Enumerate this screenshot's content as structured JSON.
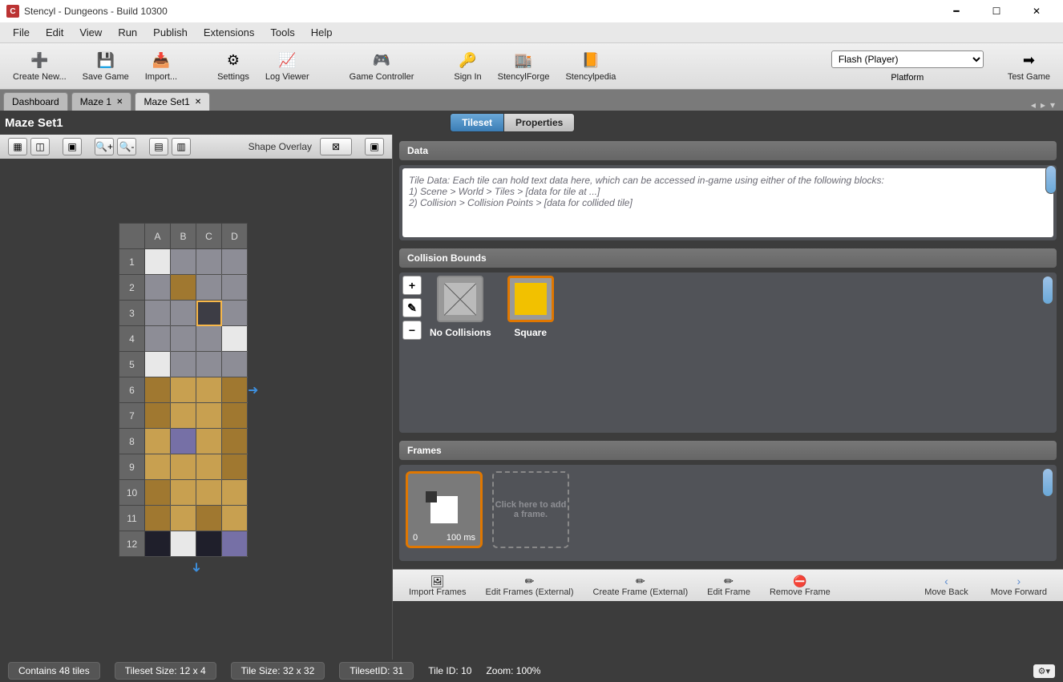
{
  "window": {
    "title": "Stencyl - Dungeons - Build 10300"
  },
  "menu": [
    "File",
    "Edit",
    "View",
    "Run",
    "Publish",
    "Extensions",
    "Tools",
    "Help"
  ],
  "toolbar": [
    {
      "label": "Create New...",
      "icon": "➕"
    },
    {
      "label": "Save Game",
      "icon": "💾"
    },
    {
      "label": "Import...",
      "icon": "📥"
    },
    {
      "label": "Settings",
      "icon": "⚙"
    },
    {
      "label": "Log Viewer",
      "icon": "📈"
    },
    {
      "label": "Game Controller",
      "icon": "🎮"
    },
    {
      "label": "Sign In",
      "icon": "🔑"
    },
    {
      "label": "StencylForge",
      "icon": "🏬"
    },
    {
      "label": "Stencylpedia",
      "icon": "📙"
    }
  ],
  "platform": {
    "value": "Flash (Player)",
    "label": "Platform"
  },
  "testgame": {
    "label": "Test Game"
  },
  "tabs": [
    {
      "label": "Dashboard",
      "closeable": false,
      "active": false
    },
    {
      "label": "Maze 1",
      "closeable": true,
      "active": false
    },
    {
      "label": "Maze Set1",
      "closeable": true,
      "active": true
    }
  ],
  "page": {
    "title": "Maze Set1"
  },
  "toggle": {
    "tileset": "Tileset",
    "properties": "Properties"
  },
  "left_toolbar": {
    "shape_overlay": "Shape Overlay"
  },
  "tile_columns": [
    "A",
    "B",
    "C",
    "D"
  ],
  "tile_rows": [
    "1",
    "2",
    "3",
    "4",
    "5",
    "6",
    "7",
    "8",
    "9",
    "10",
    "11",
    "12"
  ],
  "sections": {
    "data": {
      "header": "Data",
      "text1": "Tile Data: Each tile can hold text data here, which can be accessed in-game using either of the following blocks:",
      "text2": "1) Scene > World > Tiles > [data for tile at ...]",
      "text3": "2) Collision > Collision Points > [data for collided tile]"
    },
    "collision": {
      "header": "Collision Bounds",
      "no_collisions": "No Collisions",
      "square": "Square"
    },
    "frames": {
      "header": "Frames",
      "index": "0",
      "duration": "100 ms",
      "add_text": "Click here to add a frame."
    }
  },
  "frames_toolbar": {
    "import": "Import Frames",
    "edit_external": "Edit Frames (External)",
    "create_external": "Create Frame (External)",
    "edit_frame": "Edit Frame",
    "remove_frame": "Remove Frame",
    "move_back": "Move Back",
    "move_forward": "Move Forward"
  },
  "status": {
    "tiles": "Contains 48 tiles",
    "tileset_size": "Tileset Size: 12 x 4",
    "tile_size": "Tile Size: 32 x 32",
    "tileset_id": "TilesetID: 31",
    "tile_id": "Tile ID: 10",
    "zoom": "Zoom: 100%"
  }
}
